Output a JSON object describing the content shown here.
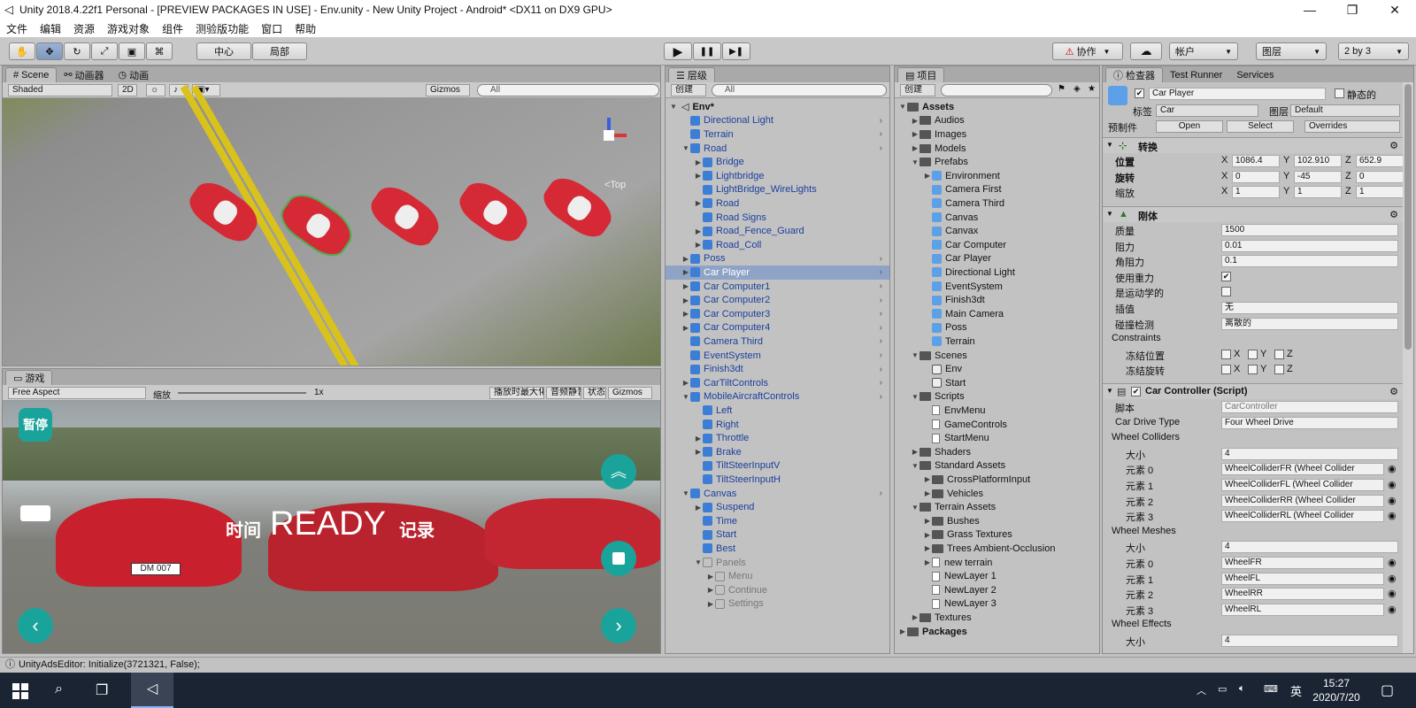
{
  "window": {
    "title": "Unity 2018.4.22f1 Personal - [PREVIEW PACKAGES IN USE] - Env.unity - New Unity Project - Android* <DX11 on DX9 GPU>",
    "min": "—",
    "max": "❐",
    "close": "✕"
  },
  "menu": [
    "文件",
    "编辑",
    "资源",
    "游戏对象",
    "组件",
    "测验版功能",
    "窗口",
    "帮助"
  ],
  "toolbar": {
    "tools": [
      "✋",
      "✥",
      "↻",
      "⤢",
      "▣",
      "⌘"
    ],
    "pivot": "中心",
    "local": "局部",
    "play": "▶",
    "pause": "❚❚",
    "step": "▶❚",
    "collab": "协作",
    "cloud": "☁",
    "account": "帐户",
    "layers": "图层",
    "layout": "2 by 3"
  },
  "scene_panel": {
    "tabs": [
      "Scene",
      "动画器",
      "动画"
    ],
    "shading": "Shaded",
    "mode2d": "2D",
    "gizmos": "Gizmos",
    "search_placeholder": "All",
    "top_label": "<Top"
  },
  "game_panel": {
    "tab": "游戏",
    "aspect": "Free Aspect",
    "scale_label": "缩放",
    "scale_value": "1x",
    "btn_max": "播放时最大化",
    "btn_mute": "音频静音",
    "btn_stats": "状态",
    "gizmos": "Gizmos",
    "pause": "暂停",
    "hud_time": "时间",
    "hud_ready": "READY",
    "hud_record": "记录",
    "plate": "DM 007"
  },
  "hierarchy": {
    "tab": "层级",
    "create": "创建",
    "search_placeholder": "All",
    "scene": "Env*",
    "items": [
      {
        "label": "Directional Light",
        "indent": 1,
        "arrow": "",
        "kind": "cube",
        "chev": true
      },
      {
        "label": "Terrain",
        "indent": 1,
        "arrow": "",
        "kind": "cube",
        "chev": true
      },
      {
        "label": "Road",
        "indent": 1,
        "arrow": "▼",
        "kind": "cube",
        "chev": true
      },
      {
        "label": "Bridge",
        "indent": 2,
        "arrow": "▶",
        "kind": "cube",
        "chev": false
      },
      {
        "label": "Lightbridge",
        "indent": 2,
        "arrow": "▶",
        "kind": "cube",
        "chev": false
      },
      {
        "label": "LightBridge_WireLights",
        "indent": 2,
        "arrow": "",
        "kind": "cube",
        "chev": false
      },
      {
        "label": "Road",
        "indent": 2,
        "arrow": "▶",
        "kind": "cube",
        "chev": false
      },
      {
        "label": "Road Signs",
        "indent": 2,
        "arrow": "",
        "kind": "cube",
        "chev": false
      },
      {
        "label": "Road_Fence_Guard",
        "indent": 2,
        "arrow": "▶",
        "kind": "cube",
        "chev": false
      },
      {
        "label": "Road_Coll",
        "indent": 2,
        "arrow": "▶",
        "kind": "cube",
        "chev": false
      },
      {
        "label": "Poss",
        "indent": 1,
        "arrow": "▶",
        "kind": "cube",
        "chev": true
      },
      {
        "label": "Car Player",
        "indent": 1,
        "arrow": "▶",
        "kind": "cube",
        "chev": true,
        "sel": true
      },
      {
        "label": "Car Computer1",
        "indent": 1,
        "arrow": "▶",
        "kind": "cube",
        "chev": true
      },
      {
        "label": "Car Computer2",
        "indent": 1,
        "arrow": "▶",
        "kind": "cube",
        "chev": true
      },
      {
        "label": "Car Computer3",
        "indent": 1,
        "arrow": "▶",
        "kind": "cube",
        "chev": true
      },
      {
        "label": "Car Computer4",
        "indent": 1,
        "arrow": "▶",
        "kind": "cube",
        "chev": true
      },
      {
        "label": "Camera Third",
        "indent": 1,
        "arrow": "",
        "kind": "cube",
        "chev": true
      },
      {
        "label": "EventSystem",
        "indent": 1,
        "arrow": "",
        "kind": "cube",
        "chev": true
      },
      {
        "label": "Finish3dt",
        "indent": 1,
        "arrow": "",
        "kind": "cube",
        "chev": true
      },
      {
        "label": "CarTiltControls",
        "indent": 1,
        "arrow": "▶",
        "kind": "cube",
        "chev": true
      },
      {
        "label": "MobileAircraftControls",
        "indent": 1,
        "arrow": "▼",
        "kind": "cube",
        "chev": true
      },
      {
        "label": "Left",
        "indent": 2,
        "arrow": "",
        "kind": "cube",
        "chev": false
      },
      {
        "label": "Right",
        "indent": 2,
        "arrow": "",
        "kind": "cube",
        "chev": false
      },
      {
        "label": "Throttle",
        "indent": 2,
        "arrow": "▶",
        "kind": "cube",
        "chev": false
      },
      {
        "label": "Brake",
        "indent": 2,
        "arrow": "▶",
        "kind": "cube",
        "chev": false
      },
      {
        "label": "TiltSteerInputV",
        "indent": 2,
        "arrow": "",
        "kind": "cube",
        "chev": false
      },
      {
        "label": "TiltSteerInputH",
        "indent": 2,
        "arrow": "",
        "kind": "cube",
        "chev": false
      },
      {
        "label": "Canvas",
        "indent": 1,
        "arrow": "▼",
        "kind": "cube",
        "chev": true
      },
      {
        "label": "Suspend",
        "indent": 2,
        "arrow": "▶",
        "kind": "cube",
        "chev": false
      },
      {
        "label": "Time",
        "indent": 2,
        "arrow": "",
        "kind": "cube",
        "chev": false
      },
      {
        "label": "Start",
        "indent": 2,
        "arrow": "",
        "kind": "cube",
        "chev": false
      },
      {
        "label": "Best",
        "indent": 2,
        "arrow": "",
        "kind": "cube",
        "chev": false
      },
      {
        "label": "Panels",
        "indent": 2,
        "arrow": "▼",
        "kind": "ghost",
        "chev": false,
        "dim": true
      },
      {
        "label": "Menu",
        "indent": 3,
        "arrow": "▶",
        "kind": "ghost",
        "chev": false,
        "dim": true
      },
      {
        "label": "Continue",
        "indent": 3,
        "arrow": "▶",
        "kind": "ghost",
        "chev": false,
        "dim": true
      },
      {
        "label": "Settings",
        "indent": 3,
        "arrow": "▶",
        "kind": "ghost",
        "chev": false,
        "dim": true
      }
    ]
  },
  "project": {
    "tab": "项目",
    "create": "创建",
    "items": [
      {
        "label": "Assets",
        "indent": 0,
        "arrow": "▼",
        "kind": "folder",
        "bold": true
      },
      {
        "label": "Audios",
        "indent": 1,
        "arrow": "▶",
        "kind": "folder"
      },
      {
        "label": "Images",
        "indent": 1,
        "arrow": "▶",
        "kind": "folder"
      },
      {
        "label": "Models",
        "indent": 1,
        "arrow": "▶",
        "kind": "folder"
      },
      {
        "label": "Prefabs",
        "indent": 1,
        "arrow": "▼",
        "kind": "folder"
      },
      {
        "label": "Environment",
        "indent": 2,
        "arrow": "▶",
        "kind": "prefab"
      },
      {
        "label": "Camera First",
        "indent": 2,
        "arrow": "",
        "kind": "prefab"
      },
      {
        "label": "Camera Third",
        "indent": 2,
        "arrow": "",
        "kind": "prefab"
      },
      {
        "label": "Canvas",
        "indent": 2,
        "arrow": "",
        "kind": "prefab"
      },
      {
        "label": "Canvax",
        "indent": 2,
        "arrow": "",
        "kind": "prefab"
      },
      {
        "label": "Car Computer",
        "indent": 2,
        "arrow": "",
        "kind": "prefab"
      },
      {
        "label": "Car Player",
        "indent": 2,
        "arrow": "",
        "kind": "prefab"
      },
      {
        "label": "Directional Light",
        "indent": 2,
        "arrow": "",
        "kind": "prefab"
      },
      {
        "label": "EventSystem",
        "indent": 2,
        "arrow": "",
        "kind": "prefab"
      },
      {
        "label": "Finish3dt",
        "indent": 2,
        "arrow": "",
        "kind": "prefab"
      },
      {
        "label": "Main Camera",
        "indent": 2,
        "arrow": "",
        "kind": "prefab"
      },
      {
        "label": "Poss",
        "indent": 2,
        "arrow": "",
        "kind": "prefab"
      },
      {
        "label": "Terrain",
        "indent": 2,
        "arrow": "",
        "kind": "prefab"
      },
      {
        "label": "Scenes",
        "indent": 1,
        "arrow": "▼",
        "kind": "folder"
      },
      {
        "label": "Env",
        "indent": 2,
        "arrow": "",
        "kind": "scene"
      },
      {
        "label": "Start",
        "indent": 2,
        "arrow": "",
        "kind": "scene"
      },
      {
        "label": "Scripts",
        "indent": 1,
        "arrow": "▼",
        "kind": "folder"
      },
      {
        "label": "EnvMenu",
        "indent": 2,
        "arrow": "",
        "kind": "script"
      },
      {
        "label": "GameControls",
        "indent": 2,
        "arrow": "",
        "kind": "script"
      },
      {
        "label": "StartMenu",
        "indent": 2,
        "arrow": "",
        "kind": "script"
      },
      {
        "label": "Shaders",
        "indent": 1,
        "arrow": "▶",
        "kind": "folder"
      },
      {
        "label": "Standard Assets",
        "indent": 1,
        "arrow": "▼",
        "kind": "folder"
      },
      {
        "label": "CrossPlatformInput",
        "indent": 2,
        "arrow": "▶",
        "kind": "folder"
      },
      {
        "label": "Vehicles",
        "indent": 2,
        "arrow": "▶",
        "kind": "folder"
      },
      {
        "label": "Terrain Assets",
        "indent": 1,
        "arrow": "▼",
        "kind": "folder"
      },
      {
        "label": "Bushes",
        "indent": 2,
        "arrow": "▶",
        "kind": "folder"
      },
      {
        "label": "Grass Textures",
        "indent": 2,
        "arrow": "▶",
        "kind": "folder"
      },
      {
        "label": "Trees Ambient-Occlusion",
        "indent": 2,
        "arrow": "▶",
        "kind": "folder"
      },
      {
        "label": "new terrain",
        "indent": 2,
        "arrow": "▶",
        "kind": "script"
      },
      {
        "label": "NewLayer 1",
        "indent": 2,
        "arrow": "",
        "kind": "script"
      },
      {
        "label": "NewLayer 2",
        "indent": 2,
        "arrow": "",
        "kind": "script"
      },
      {
        "label": "NewLayer 3",
        "indent": 2,
        "arrow": "",
        "kind": "script"
      },
      {
        "label": "Textures",
        "indent": 1,
        "arrow": "▶",
        "kind": "folder"
      },
      {
        "label": "Packages",
        "indent": 0,
        "arrow": "▶",
        "kind": "folder",
        "bold": true
      }
    ]
  },
  "inspector": {
    "tabs": [
      "检查器",
      "Test Runner",
      "Services"
    ],
    "name": "Car Player",
    "static_label": "静态的",
    "tag_label": "标签",
    "tag_value": "Car",
    "layer_label": "图层",
    "layer_value": "Default",
    "prefab_label": "预制件",
    "prefab_open": "Open",
    "prefab_select": "Select",
    "prefab_overrides": "Overrides",
    "transform": {
      "title": "转换",
      "position_label": "位置",
      "pos": [
        "1086.4",
        "102.910",
        "652.9"
      ],
      "rotation_label": "旋转",
      "rot": [
        "0",
        "-45",
        "0"
      ],
      "scale_label": "缩放",
      "scale": [
        "1",
        "1",
        "1"
      ]
    },
    "rigidbody": {
      "title": "刚体",
      "rows": [
        {
          "label": "质量",
          "value": "1500"
        },
        {
          "label": "阻力",
          "value": "0.01"
        },
        {
          "label": "角阻力",
          "value": "0.1"
        }
      ],
      "gravity_label": "使用重力",
      "kinematic_label": "是运动学的",
      "interp_label": "插值",
      "interp_value": "无",
      "collision_label": "碰撞检测",
      "collision_value": "离散的",
      "constraints_label": "Constraints",
      "freeze_pos": "冻结位置",
      "freeze_rot": "冻结旋转"
    },
    "carcontroller": {
      "title": "Car Controller (Script)",
      "script_label": "脚本",
      "script_value": "CarController",
      "drive_label": "Car Drive Type",
      "drive_value": "Four Wheel Drive",
      "wc_label": "Wheel Colliders",
      "size_label": "大小",
      "wc_size": "4",
      "wc_items": [
        {
          "label": "元素 0",
          "value": "WheelColliderFR (Wheel Collider"
        },
        {
          "label": "元素 1",
          "value": "WheelColliderFL (Wheel Collider"
        },
        {
          "label": "元素 2",
          "value": "WheelColliderRR (Wheel Collider"
        },
        {
          "label": "元素 3",
          "value": "WheelColliderRL (Wheel Collider"
        }
      ],
      "wm_label": "Wheel Meshes",
      "wm_size": "4",
      "wm_items": [
        {
          "label": "元素 0",
          "value": "WheelFR"
        },
        {
          "label": "元素 1",
          "value": "WheelFL"
        },
        {
          "label": "元素 2",
          "value": "WheelRR"
        },
        {
          "label": "元素 3",
          "value": "WheelRL"
        }
      ],
      "we_label": "Wheel Effects",
      "we_size": "4"
    },
    "axis": [
      "X",
      "Y",
      "Z"
    ]
  },
  "status": {
    "text": "UnityAdsEditor: Initialize(3721321, False);"
  },
  "taskbar": {
    "time": "15:27",
    "date": "2020/7/20",
    "ime": "英"
  }
}
